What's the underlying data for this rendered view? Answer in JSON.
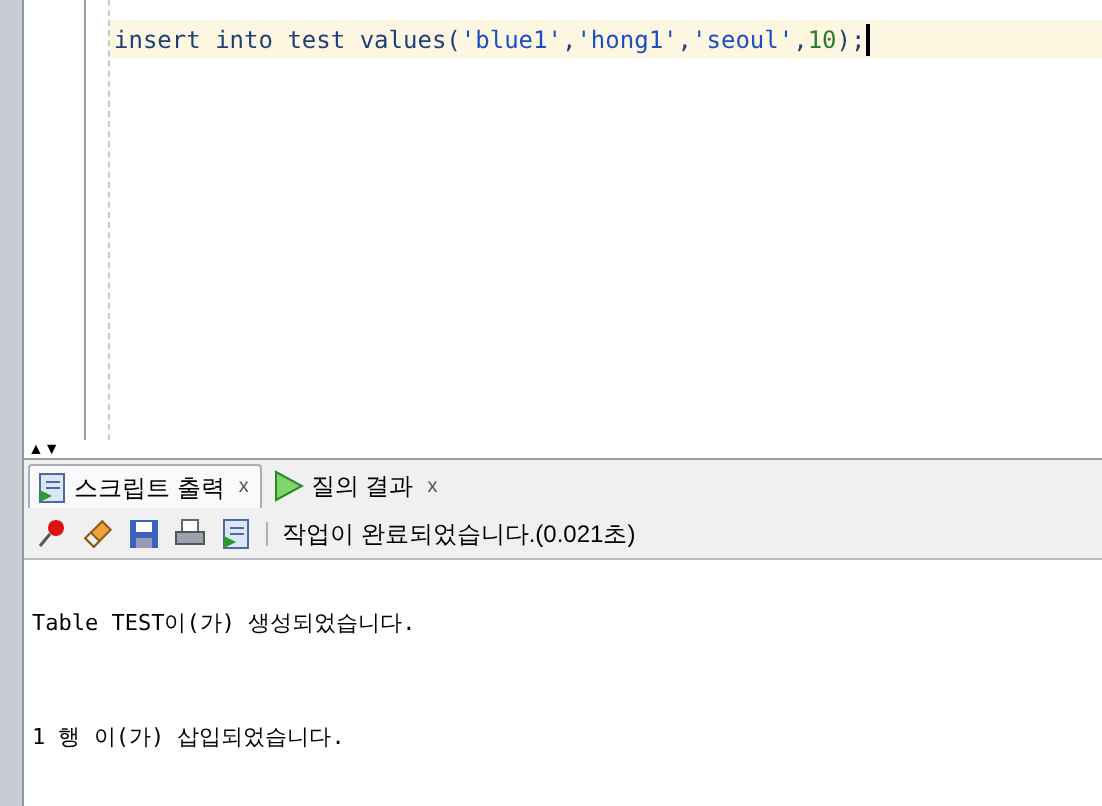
{
  "editor": {
    "code_tokens": [
      {
        "text": "insert into test values(",
        "kind": "keyword"
      },
      {
        "text": "'blue1'",
        "kind": "string"
      },
      {
        "text": ",",
        "kind": "keyword"
      },
      {
        "text": "'hong1'",
        "kind": "string"
      },
      {
        "text": ",",
        "kind": "keyword"
      },
      {
        "text": "'seoul'",
        "kind": "string"
      },
      {
        "text": ",",
        "kind": "keyword"
      },
      {
        "text": "10",
        "kind": "number"
      },
      {
        "text": ");",
        "kind": "keyword"
      }
    ]
  },
  "splitter": {
    "arrows": [
      "▲",
      "▼"
    ]
  },
  "tabs": [
    {
      "label": "스크립트 출력",
      "close": "x",
      "selected": true,
      "kind": "script"
    },
    {
      "label": "질의 결과",
      "close": "x",
      "selected": false,
      "kind": "query"
    }
  ],
  "toolbar": {
    "status": "작업이 완료되었습니다.(0.021초)"
  },
  "output": {
    "lines": [
      "Table TEST이(가) 생성되었습니다.",
      "1 행 이(가) 삽입되었습니다."
    ]
  }
}
